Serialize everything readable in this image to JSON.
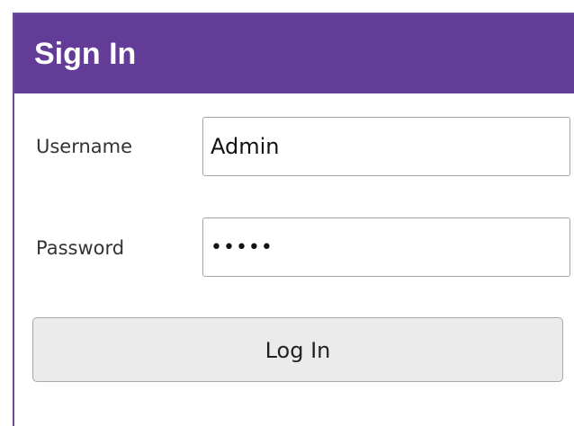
{
  "header": {
    "title": "Sign In",
    "background_color": "#623c97"
  },
  "form": {
    "username_label": "Username",
    "username_value": "Admin",
    "password_label": "Password",
    "password_value": "•••••",
    "submit_label": "Log In"
  }
}
